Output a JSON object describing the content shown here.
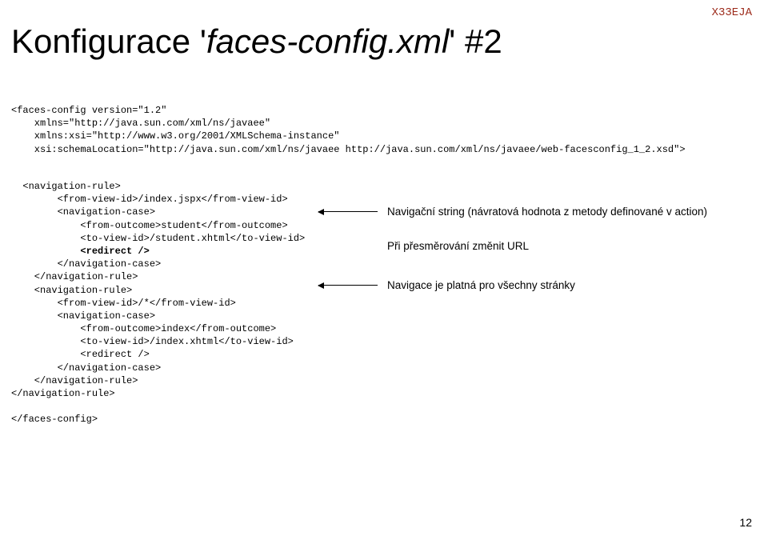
{
  "header_label": "X33EJA",
  "title_prefix": "Konfigurace '",
  "title_italic": "faces-config.xml",
  "title_suffix": "' #2",
  "code1_line1": "<faces-config version=\"1.2\"",
  "code1_line2": "    xmlns=\"http://java.sun.com/xml/ns/javaee\"",
  "code1_line3": "    xmlns:xsi=\"http://www.w3.org/2001/XMLSchema-instance\"",
  "code1_line4": "    xsi:schemaLocation=\"http://java.sun.com/xml/ns/javaee http://java.sun.com/xml/ns/javaee/web-facesconfig_1_2.xsd\">",
  "code2_line01": "  <navigation-rule>",
  "code2_line02": "        <from-view-id>/index.jspx</from-view-id>",
  "code2_line03": "        <navigation-case>",
  "code2_line04": "            <from-outcome>student</from-outcome>",
  "code2_line05": "            <to-view-id>/student.xhtml</to-view-id>",
  "code2_line06": "            <redirect />",
  "code2_line07": "        </navigation-case>",
  "code2_line08": "    </navigation-rule>",
  "code2_line09": "    <navigation-rule>",
  "code2_line10": "        <from-view-id>/*</from-view-id>",
  "code2_line11": "        <navigation-case>",
  "code2_line12": "            <from-outcome>index</from-outcome>",
  "code2_line13": "            <to-view-id>/index.xhtml</to-view-id>",
  "code2_line14": "            <redirect />",
  "code2_line15": "        </navigation-case>",
  "code2_line16": "    </navigation-rule>",
  "code2_line17": "</navigation-rule>",
  "code2_line18": "",
  "code2_line19": "</faces-config>",
  "annotation1": "Navigační string (návratová hodnota z metody definované v action)",
  "annotation2": "Při přesměrování změnit URL",
  "annotation3": "Navigace je platná pro všechny stránky",
  "page_number": "12"
}
